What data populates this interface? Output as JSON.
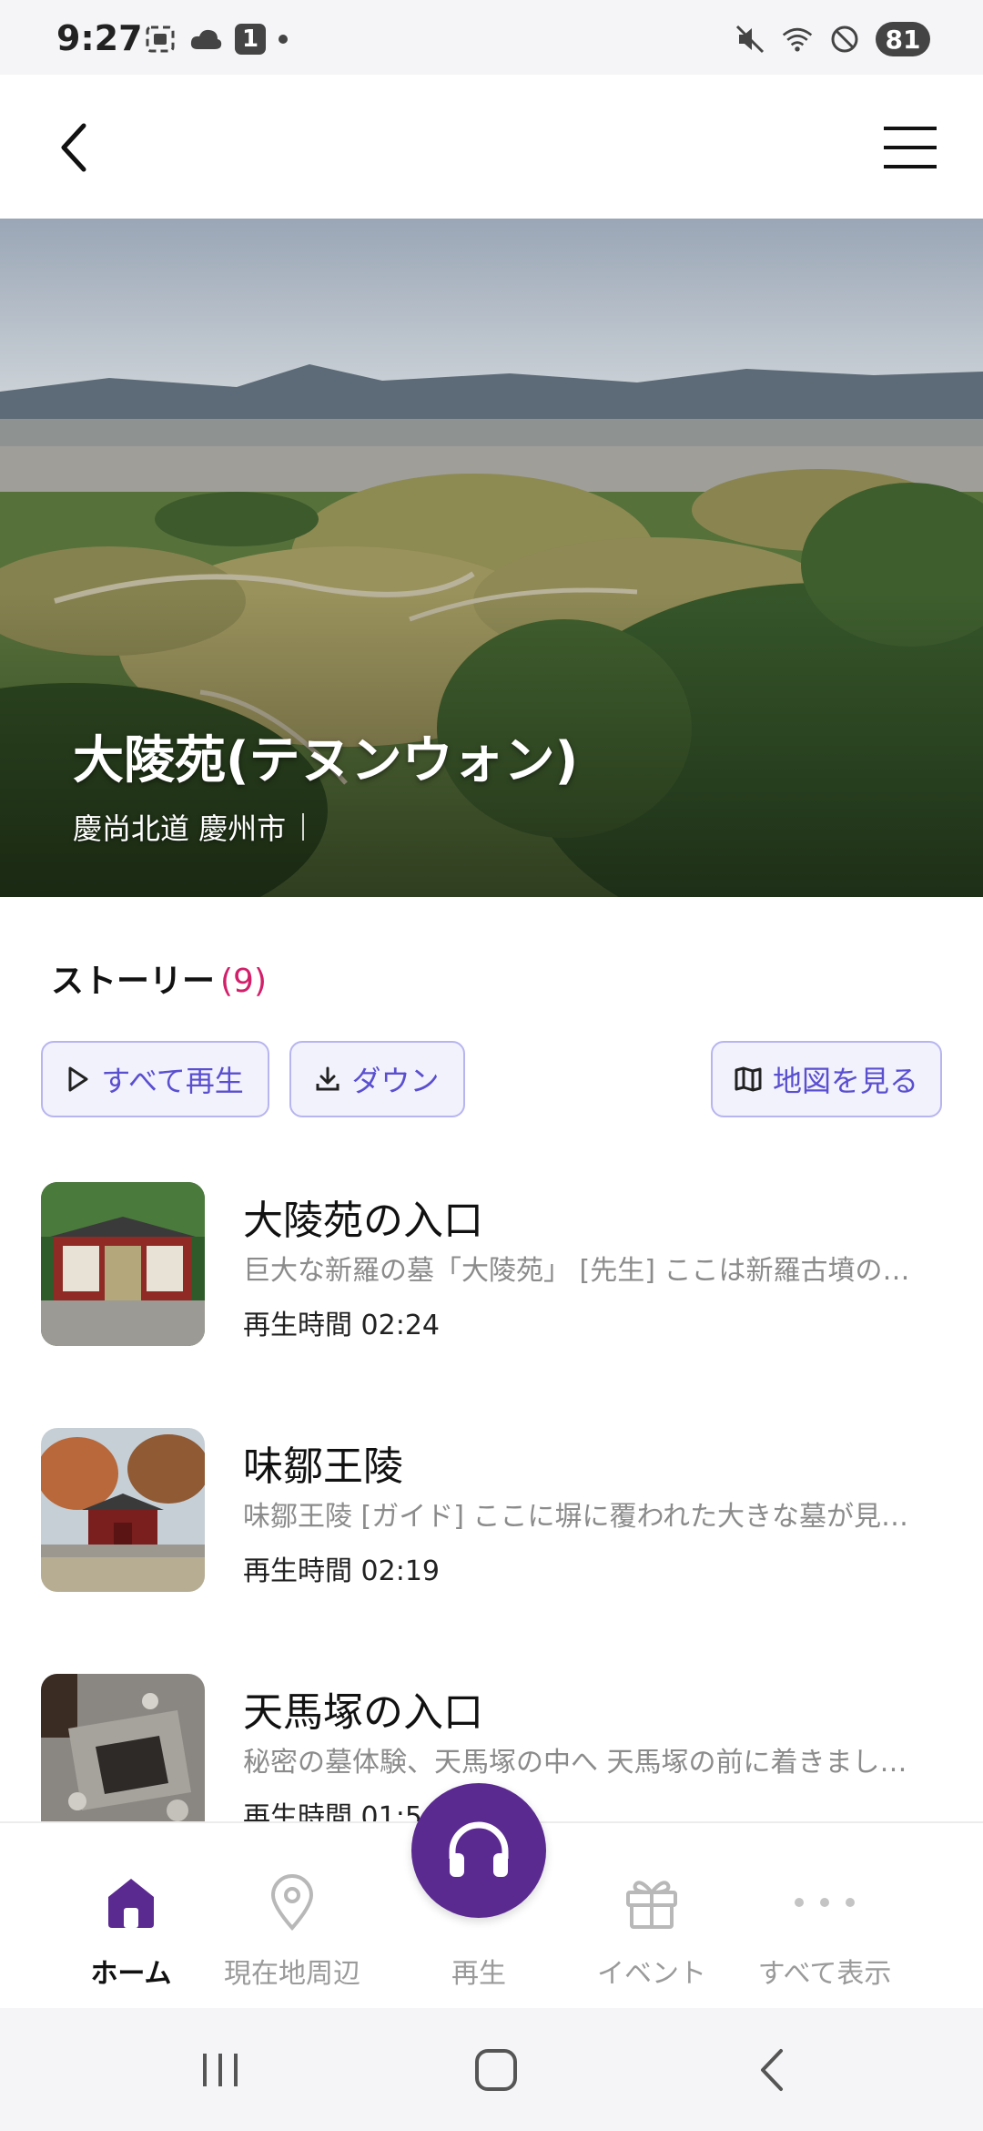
{
  "status_bar": {
    "time": "9:27",
    "notification_count": "1",
    "battery": "81",
    "icons": [
      "screenshot-icon",
      "cloud-icon",
      "notification-badge",
      "dot-icon",
      "mute-icon",
      "wifi-icon",
      "do-not-disturb-icon",
      "battery-icon"
    ]
  },
  "app_bar": {
    "back_icon": "chevron-left-icon",
    "menu_icon": "hamburger-menu-icon"
  },
  "hero": {
    "title": "大陵苑(テヌンウォン)",
    "location": "慶尚北道 慶州市"
  },
  "stories": {
    "label": "ストーリー",
    "count": "(9)",
    "actions": {
      "play_all": "すべて再生",
      "download": "ダウン",
      "view_map": "地図を見る"
    },
    "items": [
      {
        "title": "大陵苑の入口",
        "description": "巨大な新羅の墓「大陵苑」 [先生] ここは新羅古墳の…",
        "duration": "再生時間 02:24"
      },
      {
        "title": "味鄒王陵",
        "description": "味鄒王陵 [ガイド] ここに塀に覆われた大きな墓が見…",
        "duration": "再生時間 02:19"
      },
      {
        "title": "天馬塚の入口",
        "description": "秘密の墓体験、天馬塚の中へ 天馬塚の前に着きまし…",
        "duration": "再生時間 01:5"
      }
    ]
  },
  "bottom_nav": {
    "home": "ホーム",
    "nearby": "現在地周辺",
    "play": "再生",
    "events": "イベント",
    "show_all": "すべて表示"
  },
  "colors": {
    "accent_purple": "#5b2a91",
    "button_text": "#5a4fcf",
    "count_pink": "#d21f6a"
  }
}
